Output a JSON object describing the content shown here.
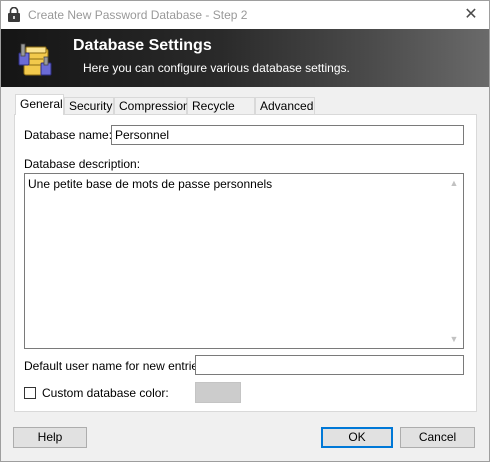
{
  "window": {
    "title": "Create New Password Database - Step 2",
    "close_glyph": "✕"
  },
  "banner": {
    "title": "Database Settings",
    "subtitle": "Here you can configure various database settings.",
    "icon": "database-settings-icon"
  },
  "tabs": [
    {
      "label": "General",
      "active": true
    },
    {
      "label": "Security",
      "active": false
    },
    {
      "label": "Compression",
      "active": false
    },
    {
      "label": "Recycle Bin",
      "active": false
    },
    {
      "label": "Advanced",
      "active": false
    }
  ],
  "general": {
    "name_label": "Database name:",
    "name_value": "Personnel",
    "description_label": "Database description:",
    "description_value": "Une petite base de mots de passe personnels",
    "default_user_label": "Default user name for new entries:",
    "default_user_value": "",
    "custom_color_label": "Custom database color:",
    "custom_color_checked": false,
    "custom_color_swatch": "#cccccc"
  },
  "buttons": {
    "help": "Help",
    "ok": "OK",
    "cancel": "Cancel"
  },
  "colors": {
    "accent": "#0078d7"
  }
}
